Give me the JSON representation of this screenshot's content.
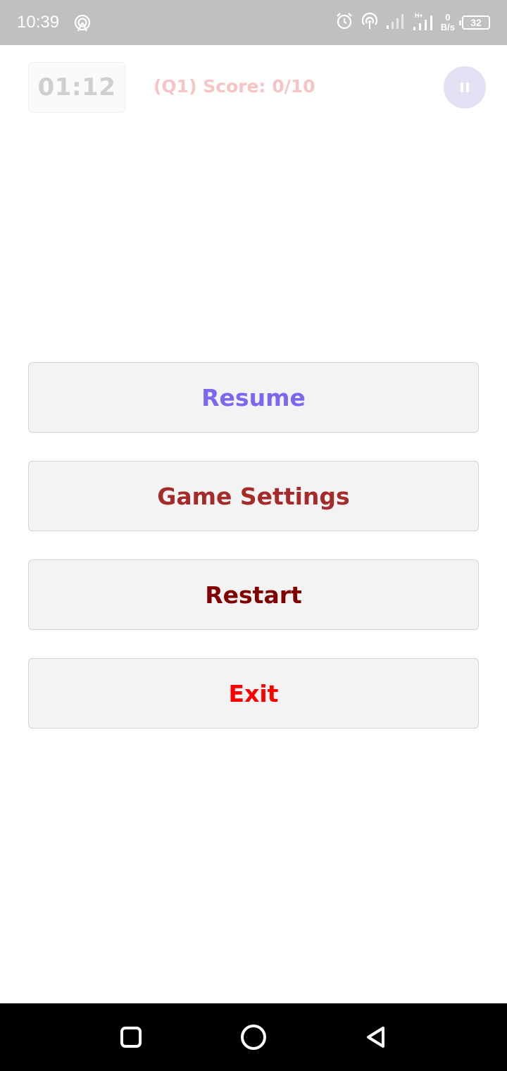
{
  "status_bar": {
    "time": "10:39",
    "speed_value": "0",
    "speed_unit": "B/s",
    "battery": "32",
    "icons": [
      "hotspot-icon",
      "alarm-icon",
      "hotspot-icon",
      "signal-icon",
      "signal-hplus-icon",
      "battery-icon"
    ]
  },
  "game": {
    "timer": "01:12",
    "score": "(Q1) Score: 0/10",
    "pause_icon": "pause-icon"
  },
  "menu": {
    "resume": "Resume",
    "settings": "Game Settings",
    "restart": "Restart",
    "exit": "Exit"
  },
  "colors": {
    "resume": "#7b68ee",
    "settings": "#a52a2a",
    "restart": "#800000",
    "exit": "#ff0000"
  },
  "nav_bar": {
    "icons": [
      "recents-icon",
      "home-icon",
      "back-icon"
    ]
  }
}
